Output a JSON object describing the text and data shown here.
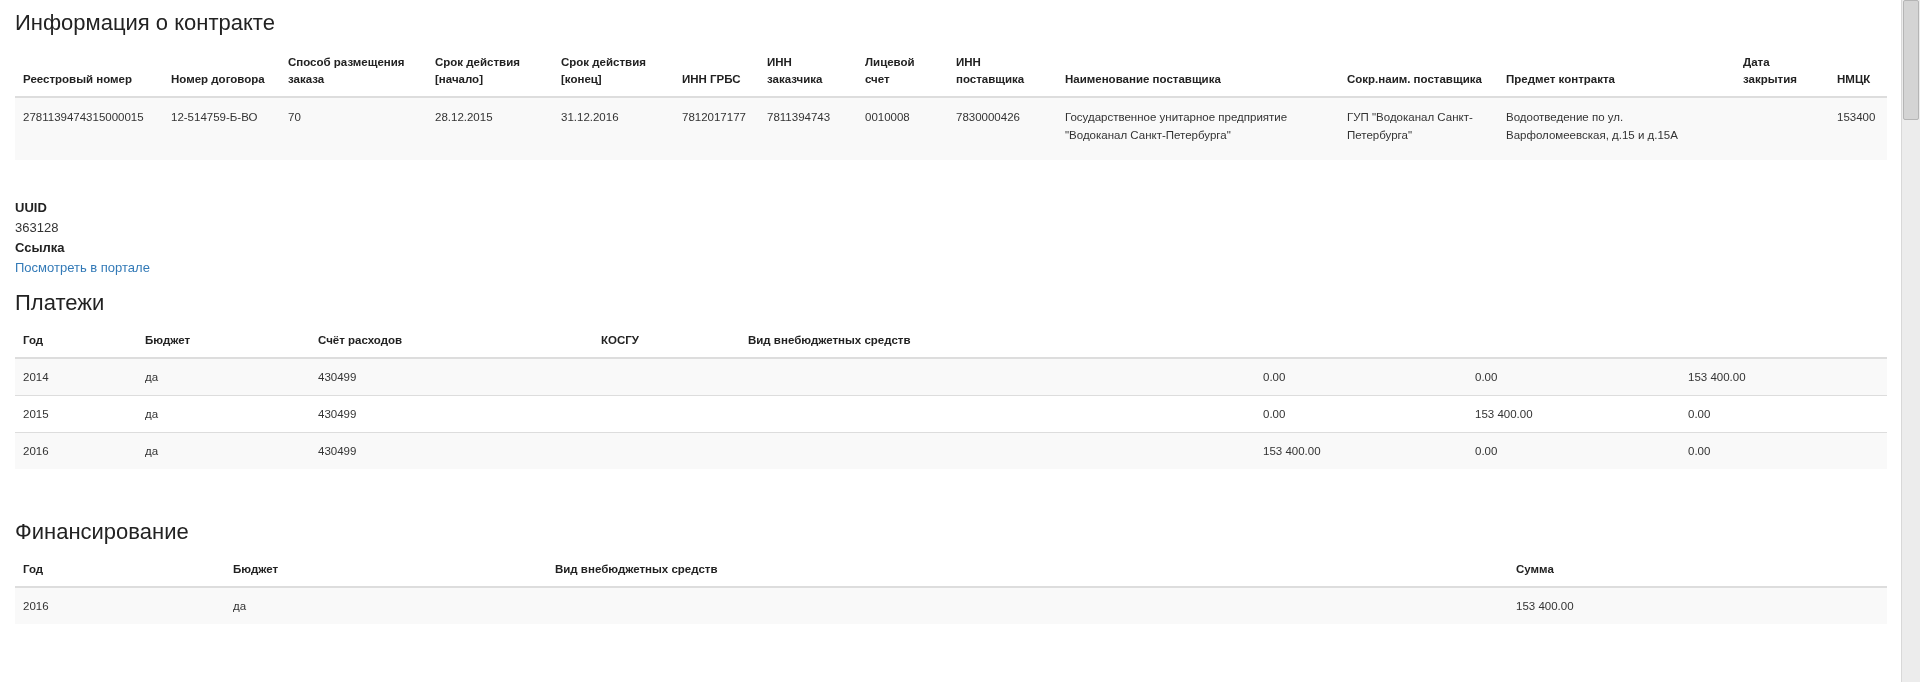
{
  "contract": {
    "title": "Информация о контракте",
    "columns": [
      "Реестровый номер",
      "Номер договора",
      "Способ размещения заказа",
      "Срок действия [начало]",
      "Срок действия [конец]",
      "ИНН ГРБС",
      "ИНН заказчика",
      "Лицевой счет",
      "ИНН поставщика",
      "Наименование поставщика",
      "Сокр.наим. поставщика",
      "Предмет контракта",
      "Дата закрытия",
      "НМЦК"
    ],
    "rows": [
      [
        "2781139474315000015",
        "12-514759-Б-ВО",
        "70",
        "28.12.2015",
        "31.12.2016",
        "7812017177",
        "7811394743",
        "0010008",
        "7830000426",
        "Государственное унитарное предприятие \"Водоканал Санкт-Петербурга\"",
        "ГУП \"Водоканал Санкт-Петербурга\"",
        "Водоотведение по ул. Варфоломеевская, д.15 и д.15А",
        null,
        "153400"
      ]
    ]
  },
  "details": [
    {
      "kind": "label",
      "text": "UUID"
    },
    {
      "kind": "text",
      "text": "363128"
    },
    {
      "kind": "label",
      "text": "Ссылка"
    },
    {
      "kind": "link",
      "text": "Посмотреть в портале"
    }
  ],
  "payments": {
    "title": "Платежи",
    "columns": [
      "Год",
      "Бюджет",
      "Счёт расходов",
      "КОСГУ",
      "Вид внебюджетных средств"
    ],
    "rows": [
      [
        "2014",
        "да",
        "430499",
        null,
        null,
        "0.00",
        "0.00",
        "153 400.00"
      ],
      [
        "2015",
        "да",
        "430499",
        null,
        null,
        "0.00",
        "153 400.00",
        "0.00"
      ],
      [
        "2016",
        "да",
        "430499",
        null,
        null,
        "153 400.00",
        "0.00",
        "0.00"
      ]
    ]
  },
  "financing": {
    "title": "Финансирование",
    "columns": [
      "Год",
      "Бюджет",
      "Вид внебюджетных средств",
      "Сумма"
    ],
    "rows": [
      [
        "2016",
        "да",
        null,
        "153 400.00"
      ]
    ]
  }
}
